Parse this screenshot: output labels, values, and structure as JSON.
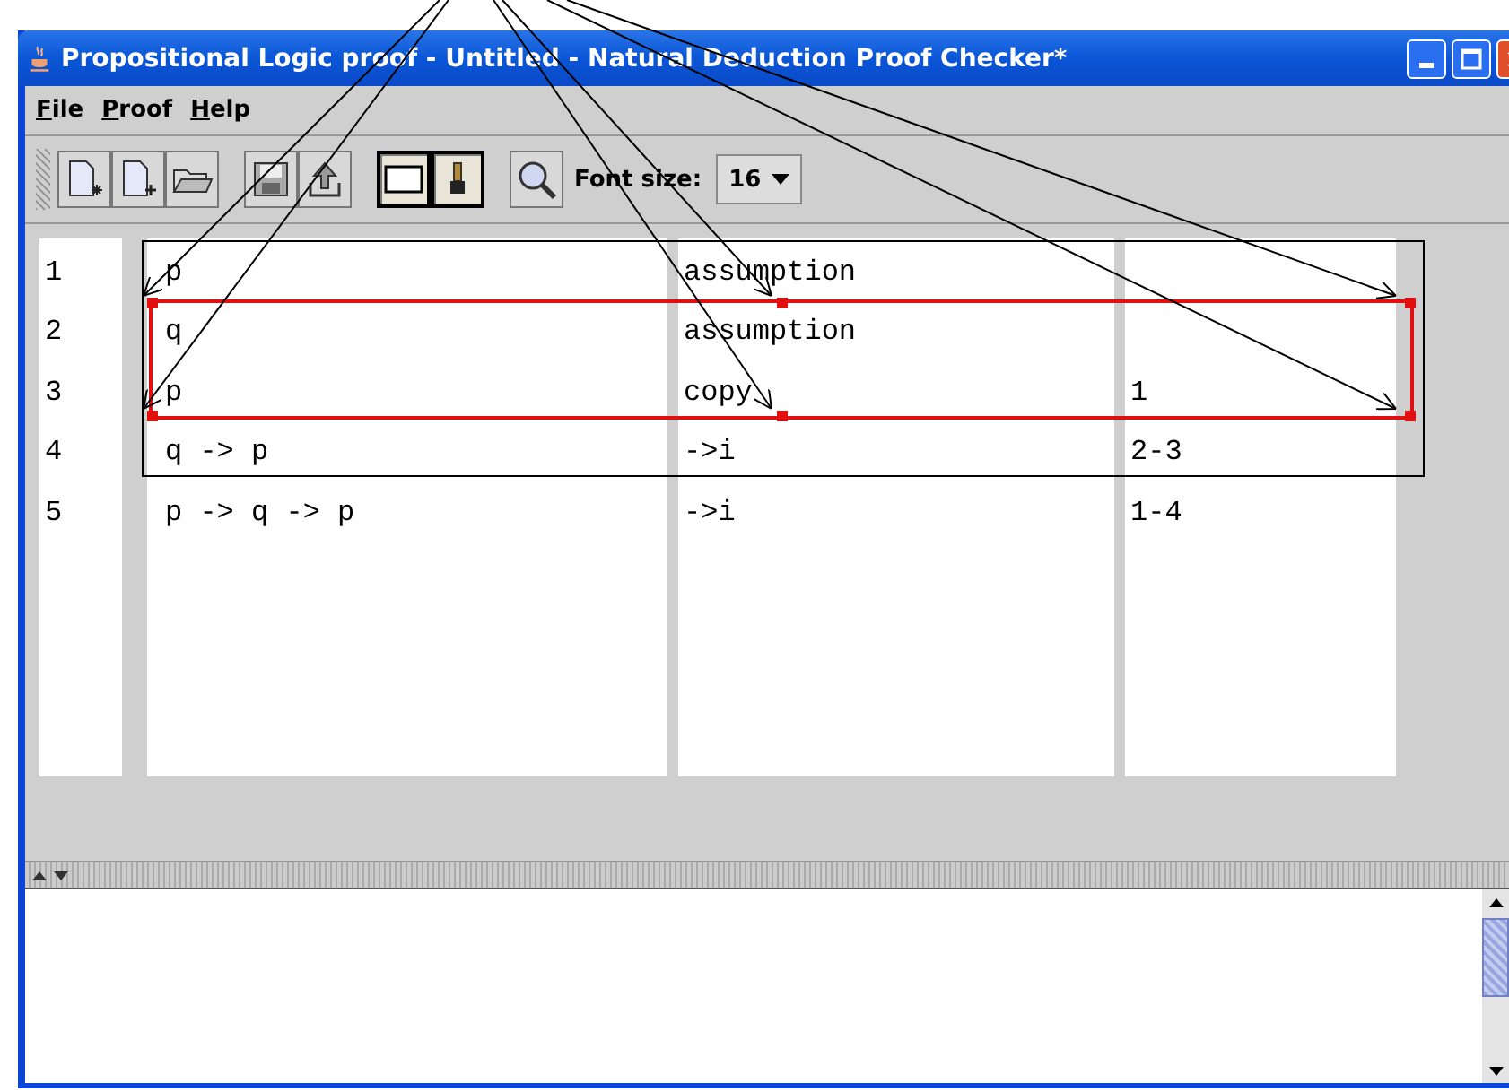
{
  "window": {
    "title": "Propositional Logic proof - Untitled - Natural Deduction Proof Checker*"
  },
  "menu": [
    {
      "label": "File"
    },
    {
      "label": "Proof"
    },
    {
      "label": "Help"
    }
  ],
  "toolbar": {
    "groups": [
      [
        {
          "kind": "new-proof",
          "pressed": false
        },
        {
          "kind": "new-line",
          "pressed": false
        },
        {
          "kind": "open",
          "pressed": false
        }
      ],
      [
        {
          "kind": "save",
          "pressed": false
        },
        {
          "kind": "export",
          "pressed": false
        }
      ],
      [
        {
          "kind": "box",
          "pressed": true
        },
        {
          "kind": "brush",
          "pressed": true
        }
      ],
      [
        {
          "kind": "zoom",
          "pressed": false
        }
      ]
    ],
    "font_size_label": "Font size:",
    "font_size": "16"
  },
  "proof": {
    "items": [
      {
        "kind": "box",
        "selected": false,
        "children": [
          {
            "kind": "line",
            "line": "1",
            "formula": "p",
            "rule": "assumption"
          },
          {
            "kind": "box",
            "selected": true,
            "children": [
              {
                "kind": "line",
                "line": "2",
                "formula": "q",
                "rule": "assumption"
              },
              {
                "kind": "line",
                "line": "3",
                "formula": "p",
                "rule": "copy",
                "refs": "1"
              }
            ]
          },
          {
            "kind": "line",
            "line": "4",
            "formula": "q -> p",
            "rule": "->i",
            "refs": "2-3"
          }
        ]
      },
      {
        "kind": "line",
        "line": "5",
        "formula": "p -> q -> p",
        "rule": "->i",
        "refs": "1-4"
      }
    ]
  }
}
